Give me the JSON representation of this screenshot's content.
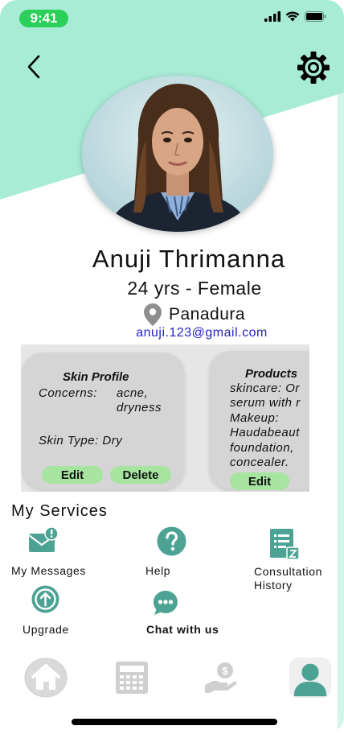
{
  "status": {
    "time": "9:41"
  },
  "profile": {
    "name": "Anuji Thrimanna",
    "age_gender": "24 yrs - Female",
    "location": "Panadura",
    "email": "anuji.123@gmail.com"
  },
  "skin_card": {
    "title": "Skin Profile",
    "concerns_label": "Concerns:",
    "concerns_value_1": "acne,",
    "concerns_value_2": "dryness",
    "skin_type": "Skin Type: Dry",
    "edit_label": "Edit",
    "delete_label": "Delete"
  },
  "products_card": {
    "title": "Products",
    "line1": "skincare: Or",
    "line2": "serum with r",
    "line3": "Makeup:",
    "line4": "Haudabeaut",
    "line5": "foundation,",
    "line6": "concealer.",
    "edit_label": "Edit"
  },
  "services": {
    "title": "My Services",
    "items": [
      {
        "label": "My Messages",
        "icon": "mail-alert-icon"
      },
      {
        "label": "Help",
        "icon": "help-icon"
      },
      {
        "label_1": "Consultation",
        "label_2": "History",
        "icon": "history-icon"
      },
      {
        "label": "Upgrade",
        "icon": "upgrade-icon"
      },
      {
        "label": "Chat with us",
        "icon": "chat-icon"
      }
    ]
  },
  "nav": [
    "home-icon",
    "calculator-icon",
    "payment-icon",
    "profile-icon"
  ],
  "colors": {
    "accent": "#a8ecd6",
    "teal": "#4da393",
    "pill": "#a7e4a0",
    "email": "#2222cc"
  }
}
